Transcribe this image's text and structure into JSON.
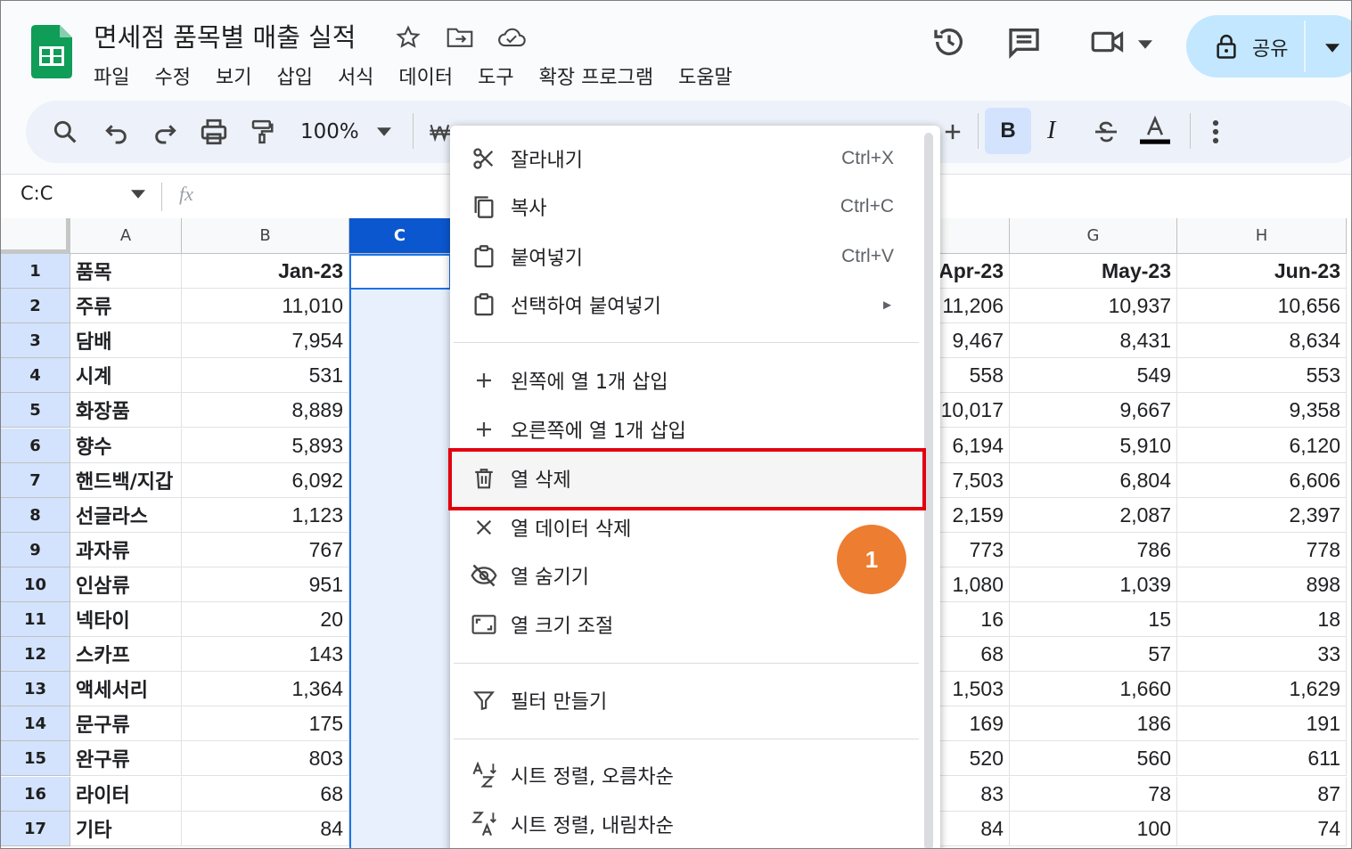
{
  "doc_title": "면세점 품목별 매출 실적",
  "menubar": [
    "파일",
    "수정",
    "보기",
    "삽입",
    "서식",
    "데이터",
    "도구",
    "확장 프로그램",
    "도움말"
  ],
  "share_label": "공유",
  "zoom": "100%",
  "name_box": "C:C",
  "fx_label": "fx",
  "columns": [
    {
      "id": "A",
      "label": "A"
    },
    {
      "id": "B",
      "label": "B"
    },
    {
      "id": "C",
      "label": "C"
    },
    {
      "id": "G",
      "label": "G"
    },
    {
      "id": "H",
      "label": "H"
    }
  ],
  "rows": [
    {
      "n": "1",
      "a": "품목",
      "b": "Jan-23",
      "f": "Apr-23",
      "g": "May-23",
      "h": "Jun-23"
    },
    {
      "n": "2",
      "a": "주류",
      "b": "11,010",
      "f": "11,206",
      "g": "10,937",
      "h": "10,656"
    },
    {
      "n": "3",
      "a": "담배",
      "b": "7,954",
      "f": "9,467",
      "g": "8,431",
      "h": "8,634"
    },
    {
      "n": "4",
      "a": "시계",
      "b": "531",
      "f": "558",
      "g": "549",
      "h": "553"
    },
    {
      "n": "5",
      "a": "화장품",
      "b": "8,889",
      "f": "10,017",
      "g": "9,667",
      "h": "9,358"
    },
    {
      "n": "6",
      "a": "향수",
      "b": "5,893",
      "f": "6,194",
      "g": "5,910",
      "h": "6,120"
    },
    {
      "n": "7",
      "a": "핸드백/지갑",
      "b": "6,092",
      "f": "7,503",
      "g": "6,804",
      "h": "6,606"
    },
    {
      "n": "8",
      "a": "선글라스",
      "b": "1,123",
      "f": "2,159",
      "g": "2,087",
      "h": "2,397"
    },
    {
      "n": "9",
      "a": "과자류",
      "b": "767",
      "f": "773",
      "g": "786",
      "h": "778"
    },
    {
      "n": "10",
      "a": "인삼류",
      "b": "951",
      "f": "1,080",
      "g": "1,039",
      "h": "898"
    },
    {
      "n": "11",
      "a": "넥타이",
      "b": "20",
      "f": "16",
      "g": "15",
      "h": "18"
    },
    {
      "n": "12",
      "a": "스카프",
      "b": "143",
      "f": "68",
      "g": "57",
      "h": "33"
    },
    {
      "n": "13",
      "a": "액세서리",
      "b": "1,364",
      "f": "1,503",
      "g": "1,660",
      "h": "1,629"
    },
    {
      "n": "14",
      "a": "문구류",
      "b": "175",
      "f": "169",
      "g": "186",
      "h": "191"
    },
    {
      "n": "15",
      "a": "완구류",
      "b": "803",
      "f": "520",
      "g": "560",
      "h": "611"
    },
    {
      "n": "16",
      "a": "라이터",
      "b": "68",
      "f": "83",
      "g": "78",
      "h": "87"
    },
    {
      "n": "17",
      "a": "기타",
      "b": "84",
      "f": "84",
      "g": "100",
      "h": "74"
    }
  ],
  "context_menu": [
    {
      "key": "cut",
      "icon": "scissors-icon",
      "label": "잘라내기",
      "shortcut": "Ctrl+X"
    },
    {
      "key": "copy",
      "icon": "copy-icon",
      "label": "복사",
      "shortcut": "Ctrl+C"
    },
    {
      "key": "paste",
      "icon": "clipboard-icon",
      "label": "붙여넣기",
      "shortcut": "Ctrl+V"
    },
    {
      "key": "paste-special",
      "icon": "clipboard-icon",
      "label": "선택하여 붙여넣기",
      "shortcut": "►"
    },
    {
      "key": "insert-left",
      "icon": "plus-icon",
      "label": "왼쪽에 열 1개 삽입",
      "shortcut": ""
    },
    {
      "key": "insert-right",
      "icon": "plus-icon",
      "label": "오른쪽에 열 1개 삽입",
      "shortcut": ""
    },
    {
      "key": "delete-column",
      "icon": "trash-icon",
      "label": "열 삭제",
      "shortcut": ""
    },
    {
      "key": "clear-column",
      "icon": "close-icon",
      "label": "열 데이터 삭제",
      "shortcut": ""
    },
    {
      "key": "hide-column",
      "icon": "eye-off-icon",
      "label": "열 숨기기",
      "shortcut": ""
    },
    {
      "key": "resize-column",
      "icon": "resize-icon",
      "label": "열 크기 조절",
      "shortcut": ""
    },
    {
      "key": "create-filter",
      "icon": "filter-icon",
      "label": "필터 만들기",
      "shortcut": ""
    },
    {
      "key": "sort-asc",
      "icon": "sort-az-icon",
      "label": "시트 정렬, 오름차순",
      "shortcut": ""
    },
    {
      "key": "sort-desc",
      "icon": "sort-za-icon",
      "label": "시트 정렬, 내림차순",
      "shortcut": ""
    }
  ],
  "callout_number": "1",
  "colors": {
    "accent": "#0b57d0",
    "highlight": "#e2000f",
    "badge": "#ed7d31",
    "share_bg": "#c2e7ff"
  }
}
